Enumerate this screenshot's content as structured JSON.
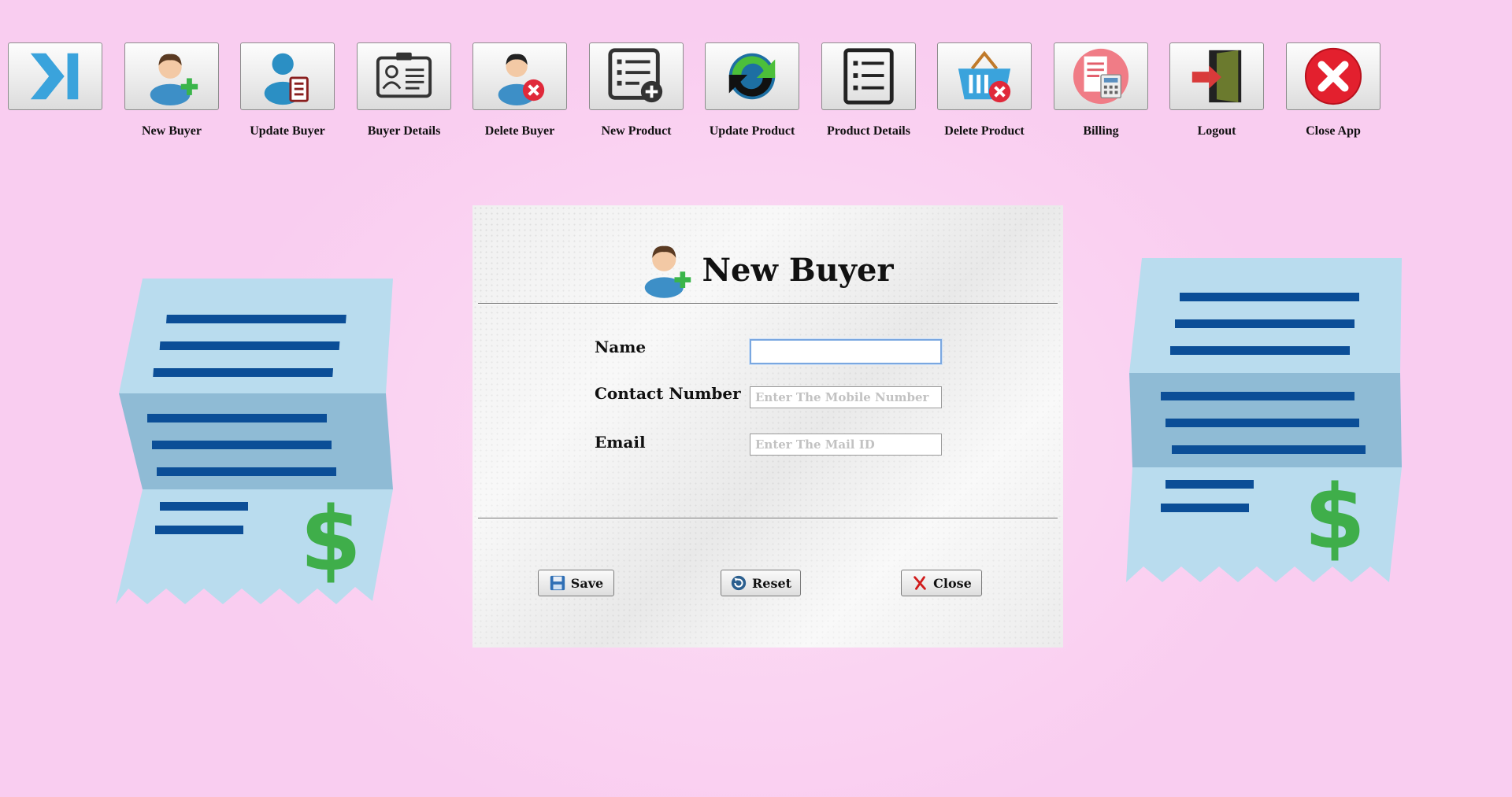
{
  "toolbar": {
    "items": [
      {
        "label": "",
        "icon": "collapse-toggle-icon"
      },
      {
        "label": "New Buyer",
        "icon": "add-user-icon"
      },
      {
        "label": "Update Buyer",
        "icon": "edit-user-icon"
      },
      {
        "label": "Buyer Details",
        "icon": "id-card-icon"
      },
      {
        "label": "Delete Buyer",
        "icon": "remove-user-icon"
      },
      {
        "label": "New Product",
        "icon": "add-list-icon"
      },
      {
        "label": "Update Product",
        "icon": "refresh-icon"
      },
      {
        "label": "Product Details",
        "icon": "list-icon"
      },
      {
        "label": "Delete Product",
        "icon": "basket-remove-icon"
      },
      {
        "label": "Billing",
        "icon": "billing-calculator-icon"
      },
      {
        "label": "Logout",
        "icon": "logout-door-icon"
      },
      {
        "label": "Close App",
        "icon": "close-circle-icon"
      }
    ]
  },
  "form": {
    "title": "New Buyer",
    "fields": {
      "name": {
        "label": "Name",
        "value": "",
        "placeholder": ""
      },
      "contact": {
        "label": "Contact Number",
        "value": "",
        "placeholder": "Enter The Mobile Number"
      },
      "email": {
        "label": "Email",
        "value": "",
        "placeholder": "Enter The Mail ID"
      }
    },
    "buttons": {
      "save": "Save",
      "reset": "Reset",
      "close": "Close"
    }
  },
  "colors": {
    "background": "#fbd7f3",
    "receipt_paper": "#b9dcee",
    "receipt_lines": "#0b4e97",
    "dollar": "#3fae4a"
  }
}
